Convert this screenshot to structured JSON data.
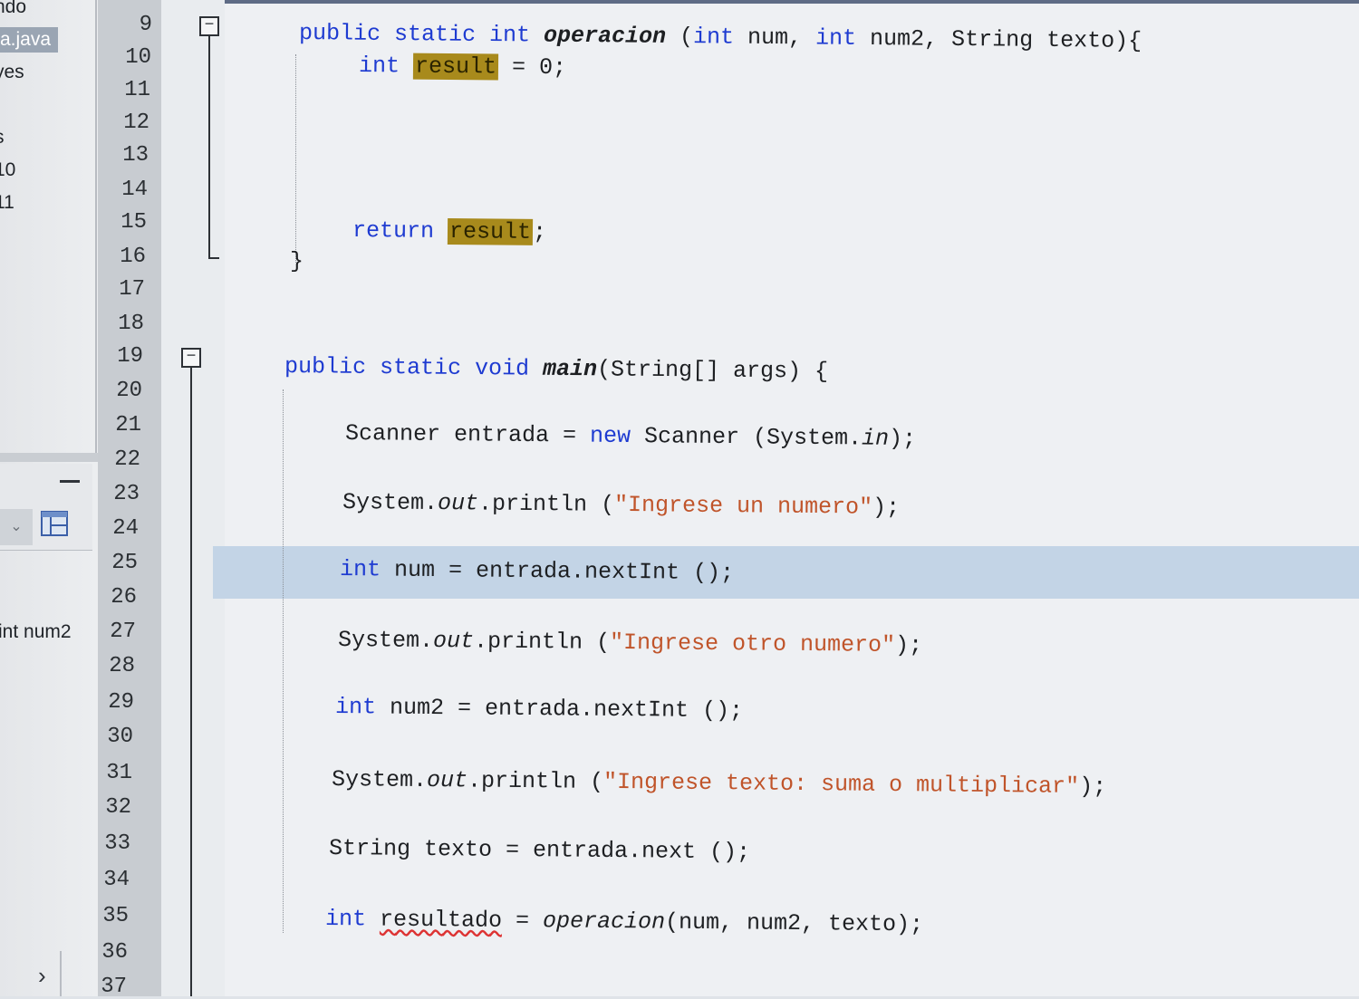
{
  "project_panel": {
    "items": [
      "ndo",
      "a.java",
      "yes",
      "s",
      "10",
      "11"
    ],
    "selected_index": 1,
    "navigator_text": "int num2"
  },
  "gutter": {
    "line_numbers": [
      "9",
      "10",
      "11",
      "12",
      "13",
      "14",
      "15",
      "16",
      "17",
      "18",
      "19",
      "20",
      "21",
      "22",
      "23",
      "24",
      "25",
      "26",
      "27",
      "28",
      "29",
      "30",
      "31",
      "32",
      "33",
      "34",
      "35",
      "36",
      "37"
    ],
    "current_line": "25"
  },
  "code": {
    "l9": {
      "kw1": "public static int ",
      "name": "operacion",
      "t1": " (",
      "kw2": "int",
      "t2": " num, ",
      "kw3": "int",
      "t3": " num2, String texto){"
    },
    "l10": {
      "kw": "int ",
      "hl": "result",
      "rest": " = 0;"
    },
    "l15": {
      "kw": "return ",
      "hl": "result",
      "rest": ";"
    },
    "l16": {
      "text": "}"
    },
    "l19": {
      "kw": "public static void ",
      "name": "main",
      "rest": "(String[] args) {"
    },
    "l21": {
      "t1": "Scanner entrada = ",
      "kw": "new",
      "t2": " Scanner (System.",
      "it": "in",
      "t3": ");"
    },
    "l23": {
      "t1": "System.",
      "it": "out",
      "t2": ".println (",
      "str": "\"Ingrese un numero\"",
      "t3": ");"
    },
    "l25": {
      "kw": "int",
      "rest": " num = entrada.nextInt ();"
    },
    "l27": {
      "t1": "System.",
      "it": "out",
      "t2": ".println (",
      "str": "\"Ingrese otro numero\"",
      "t3": ");"
    },
    "l29": {
      "kw": "int",
      "rest": " num2 = entrada.nextInt ();"
    },
    "l31": {
      "t1": "System.",
      "it": "out",
      "t2": ".println (",
      "str": "\"Ingrese texto: suma o multiplicar\"",
      "t3": ");"
    },
    "l33": {
      "text": "String texto = entrada.next ();"
    },
    "l35": {
      "kw": "int",
      "sp": " ",
      "var": "resultado",
      "t1": " = ",
      "it": "operacion",
      "t2": "(num, num2, texto);"
    }
  },
  "colors": {
    "keyword": "#1e3bd1",
    "string": "#c0542a",
    "occurrence_highlight": "#a88a1c",
    "current_line": "#c3d4e6"
  },
  "icons": [
    "minimize-icon",
    "dropdown-chevron-icon",
    "navigator-view-icon",
    "fold-collapse-icon",
    "expand-chevron-icon"
  ]
}
